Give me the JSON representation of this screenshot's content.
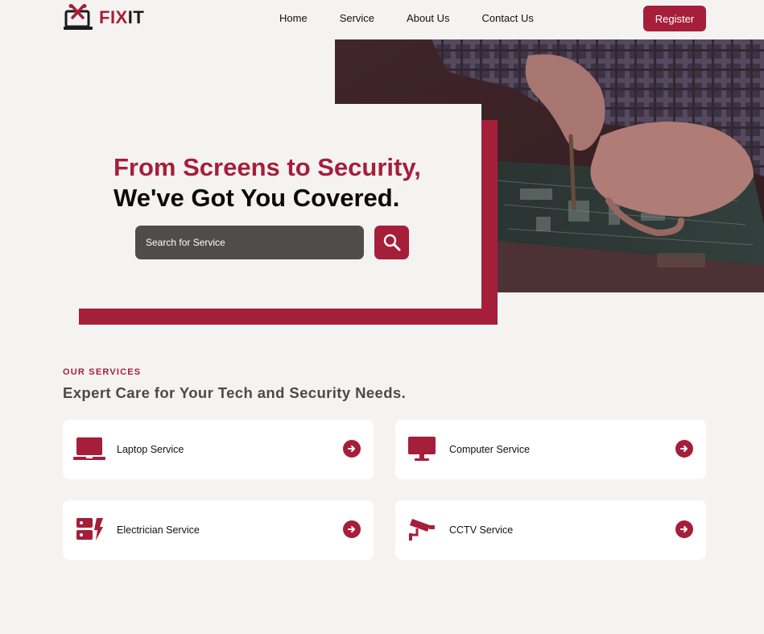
{
  "brand": {
    "logo_part1": "FIX",
    "logo_part2": "IT",
    "accent_color": "#a51f3a"
  },
  "nav": {
    "items": [
      {
        "label": "Home"
      },
      {
        "label": "Service"
      },
      {
        "label": "About Us"
      },
      {
        "label": "Contact Us"
      }
    ],
    "register_label": "Register"
  },
  "hero": {
    "title_line1": "From Screens to Security,",
    "title_line2": "We've Got You Covered.",
    "search_placeholder": "Search for Service",
    "search_icon": "search-icon",
    "image": "technician-repairing-circuit-board"
  },
  "services": {
    "eyebrow": "OUR SERVICES",
    "heading": "Expert Care for Your Tech and Security Needs.",
    "cards": [
      {
        "label": "Laptop Service",
        "icon": "laptop-icon"
      },
      {
        "label": "Computer Service",
        "icon": "monitor-icon"
      },
      {
        "label": "Electrician Service",
        "icon": "electric-panel-icon"
      },
      {
        "label": "CCTV Service",
        "icon": "cctv-camera-icon"
      }
    ]
  }
}
